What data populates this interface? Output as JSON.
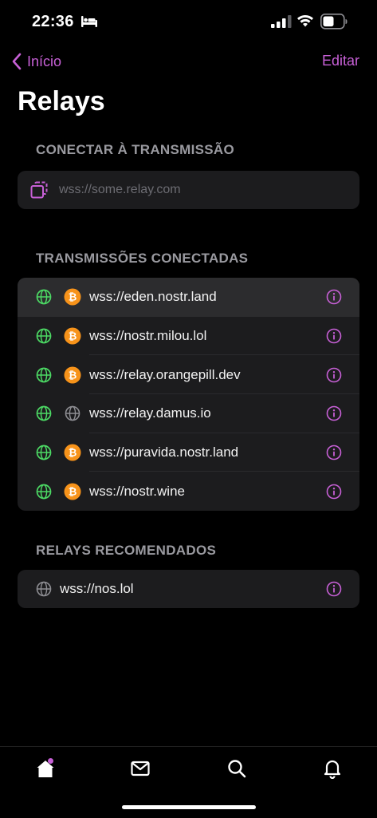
{
  "status": {
    "time": "22:36"
  },
  "nav": {
    "back_label": "Início",
    "edit_label": "Editar"
  },
  "title": "Relays",
  "connect": {
    "section_title": "CONECTAR À TRANSMISSÃO",
    "placeholder": "wss://some.relay.com"
  },
  "connected": {
    "section_title": "TRANSMISSÕES CONECTADAS",
    "relays": [
      {
        "url": "wss://eden.nostr.land",
        "type_icon": "bitcoin-icon"
      },
      {
        "url": "wss://nostr.milou.lol",
        "type_icon": "bitcoin-icon"
      },
      {
        "url": "wss://relay.orangepill.dev",
        "type_icon": "bitcoin-icon"
      },
      {
        "url": "wss://relay.damus.io",
        "type_icon": "globe-icon"
      },
      {
        "url": "wss://puravida.nostr.land",
        "type_icon": "bitcoin-icon"
      },
      {
        "url": "wss://nostr.wine",
        "type_icon": "bitcoin-icon"
      }
    ]
  },
  "recommended": {
    "section_title": "RELAYS RECOMENDADOS",
    "relays": [
      {
        "url": "wss://nos.lol"
      }
    ]
  },
  "colors": {
    "accent": "#c760d6",
    "connected_green": "#4cd964",
    "bitcoin_orange": "#f7931a",
    "card_bg": "#1c1c1e",
    "section_title": "#9a9aa0"
  },
  "tabs": [
    {
      "icon": "home-icon"
    },
    {
      "icon": "mail-icon"
    },
    {
      "icon": "search-icon"
    },
    {
      "icon": "bell-icon"
    }
  ]
}
